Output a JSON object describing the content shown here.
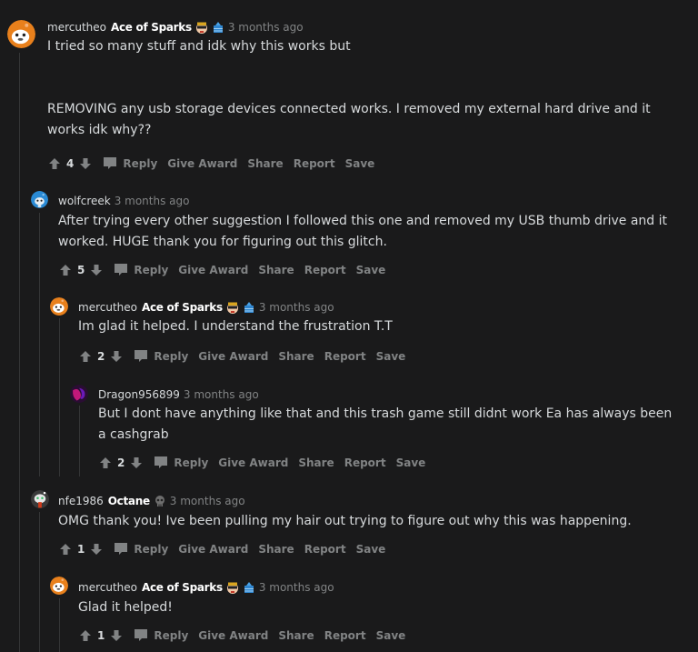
{
  "actions": {
    "reply": "Reply",
    "give_award": "Give Award",
    "share": "Share",
    "report": "Report",
    "save": "Save"
  },
  "comments": [
    {
      "username": "mercutheo",
      "flair": "Ace of Sparks",
      "flair_badges": [
        "sunglasses-face-badge",
        "blue-cake-badge"
      ],
      "timestamp": "3 months ago",
      "body_lines": [
        "I tried so many stuff and idk why this works but",
        "",
        "",
        "REMOVING any usb storage devices connected works. I removed my external hard drive and it",
        "works idk why??"
      ],
      "score": "4",
      "avatar_color": "#e8801c",
      "depth": 0
    },
    {
      "username": "wolfcreek",
      "flair": "",
      "timestamp": "3 months ago",
      "body_lines": [
        "After trying every other suggestion I followed this one and removed my USB thumb drive and it",
        "worked. HUGE thank you for figuring out this glitch."
      ],
      "score": "5",
      "avatar_color": "#2a8ad4",
      "depth": 1
    },
    {
      "username": "mercutheo",
      "flair": "Ace of Sparks",
      "flair_badges": [
        "sunglasses-face-badge",
        "blue-cake-badge"
      ],
      "timestamp": "3 months ago",
      "body_lines": [
        "Im glad it helped. I understand the frustration T.T"
      ],
      "score": "2",
      "avatar_color": "#e8801c",
      "depth": 2
    },
    {
      "username": "Dragon956899",
      "flair": "",
      "timestamp": "3 months ago",
      "body_lines": [
        "But I dont have anything like that and this trash game still didnt work Ea has always been",
        "a cashgrab"
      ],
      "score": "2",
      "avatar_color": "#8a1a8a",
      "depth": 3
    },
    {
      "username": "nfe1986",
      "flair": "Octane",
      "flair_badges": [
        "skull-badge"
      ],
      "timestamp": "3 months ago",
      "body_lines": [
        "OMG thank you! Ive been pulling my hair out trying to figure out why this was happening."
      ],
      "score": "1",
      "avatar_color": "#cfcfcf",
      "depth": 1
    },
    {
      "username": "mercutheo",
      "flair": "Ace of Sparks",
      "flair_badges": [
        "sunglasses-face-badge",
        "blue-cake-badge"
      ],
      "timestamp": "3 months ago",
      "body_lines": [
        "Glad it helped!"
      ],
      "score": "1",
      "avatar_color": "#e8801c",
      "depth": 2
    }
  ]
}
